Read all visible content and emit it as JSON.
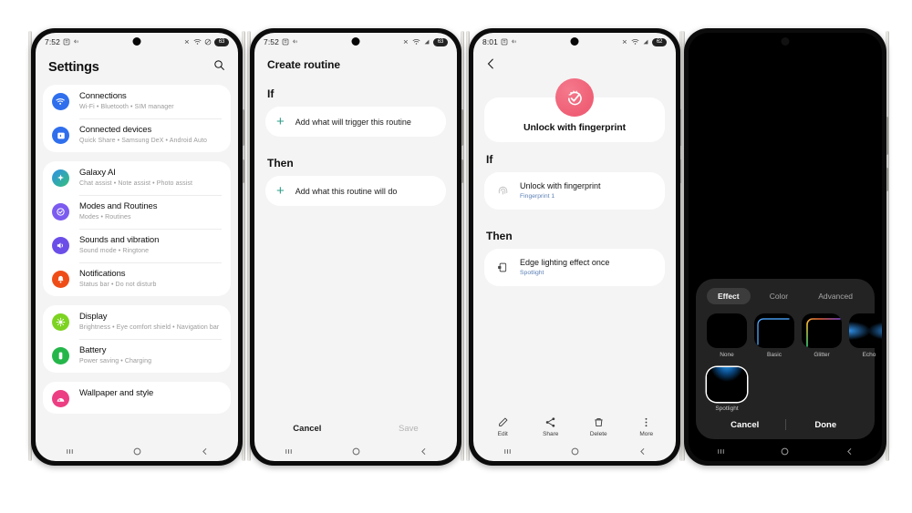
{
  "phones": [
    {
      "id": "settings",
      "status": {
        "time": "7:52",
        "icons": [
          "alarm-icon",
          "vibrate-icon"
        ],
        "right_icons": [
          "bluetooth-off-icon",
          "wifi-icon",
          "signal-icon"
        ],
        "battery": "63"
      },
      "header": {
        "title": "Settings",
        "search_icon": "search-icon"
      },
      "groups": [
        {
          "rows": [
            {
              "title": "Connections",
              "sub": "Wi-Fi • Bluetooth • SIM manager",
              "icon": "wifi-icon",
              "color": "#2f6fed"
            },
            {
              "title": "Connected devices",
              "sub": "Quick Share • Samsung DeX • Android Auto",
              "icon": "devices-icon",
              "color": "#2f6fed"
            }
          ]
        },
        {
          "rows": [
            {
              "title": "Galaxy AI",
              "sub": "Chat assist • Note assist • Photo assist",
              "icon": "sparkle-icon",
              "color": "#3ba3e8"
            },
            {
              "title": "Modes and Routines",
              "sub": "Modes • Routines",
              "icon": "routines-icon",
              "color": "#7b5bf0"
            },
            {
              "title": "Sounds and vibration",
              "sub": "Sound mode • Ringtone",
              "icon": "sound-icon",
              "color": "#6b4ee8"
            },
            {
              "title": "Notifications",
              "sub": "Status bar • Do not disturb",
              "icon": "bell-icon",
              "color": "#ef4d18"
            }
          ]
        },
        {
          "rows": [
            {
              "title": "Display",
              "sub": "Brightness • Eye comfort shield • Navigation bar",
              "icon": "brightness-icon",
              "color": "#7dd321"
            },
            {
              "title": "Battery",
              "sub": "Power saving • Charging",
              "icon": "battery-icon",
              "color": "#25b64a"
            }
          ]
        },
        {
          "rows": [
            {
              "title": "Wallpaper and style",
              "sub": "",
              "icon": "wallpaper-icon",
              "color": "#ec3e82"
            }
          ]
        }
      ],
      "navbar": [
        "recents-icon",
        "home-icon",
        "back-icon"
      ]
    },
    {
      "id": "create-routine",
      "status": {
        "time": "7:52",
        "battery": "63"
      },
      "title": "Create routine",
      "sections": [
        {
          "label": "If",
          "card_label": "Add what will trigger this routine",
          "plus": "+"
        },
        {
          "label": "Then",
          "card_label": "Add what this routine will do",
          "plus": "+"
        }
      ],
      "footer": {
        "cancel": "Cancel",
        "save": "Save"
      },
      "navbar": [
        "recents-icon",
        "home-icon",
        "back-icon"
      ]
    },
    {
      "id": "routine-detail",
      "status": {
        "time": "8:01",
        "battery": "62"
      },
      "back_icon": "back-chevron-icon",
      "hero": {
        "label": "Unlock with fingerprint",
        "icon": "check-sparkle-icon",
        "color": "#ef5f75"
      },
      "sections": [
        {
          "label": "If",
          "item_title": "Unlock with fingerprint",
          "item_sub": "Fingerprint 1",
          "icon": "fingerprint-icon"
        },
        {
          "label": "Then",
          "item_title": "Edge lighting effect once",
          "item_sub": "Spotlight",
          "icon": "edge-lighting-icon"
        }
      ],
      "actions": [
        {
          "label": "Edit",
          "icon": "pencil-icon"
        },
        {
          "label": "Share",
          "icon": "share-icon"
        },
        {
          "label": "Delete",
          "icon": "trash-icon"
        },
        {
          "label": "More",
          "icon": "more-vertical-icon"
        }
      ],
      "navbar": [
        "recents-icon",
        "home-icon",
        "back-icon"
      ]
    },
    {
      "id": "edge-lighting-picker",
      "tabs": [
        {
          "label": "Effect",
          "active": true
        },
        {
          "label": "Color",
          "active": false
        },
        {
          "label": "Advanced",
          "active": false
        }
      ],
      "effects_row1": [
        {
          "label": "None",
          "style": "none",
          "selected": false
        },
        {
          "label": "Basic",
          "style": "basic",
          "selected": false
        },
        {
          "label": "Glitter",
          "style": "glitter",
          "selected": false
        },
        {
          "label": "Echo",
          "style": "echo",
          "selected": false
        }
      ],
      "effects_row2": [
        {
          "label": "Spotlight",
          "style": "spotlight",
          "selected": true
        }
      ],
      "actions": {
        "cancel": "Cancel",
        "done": "Done"
      },
      "navbar": [
        "recents-icon",
        "home-icon",
        "back-icon"
      ]
    }
  ]
}
